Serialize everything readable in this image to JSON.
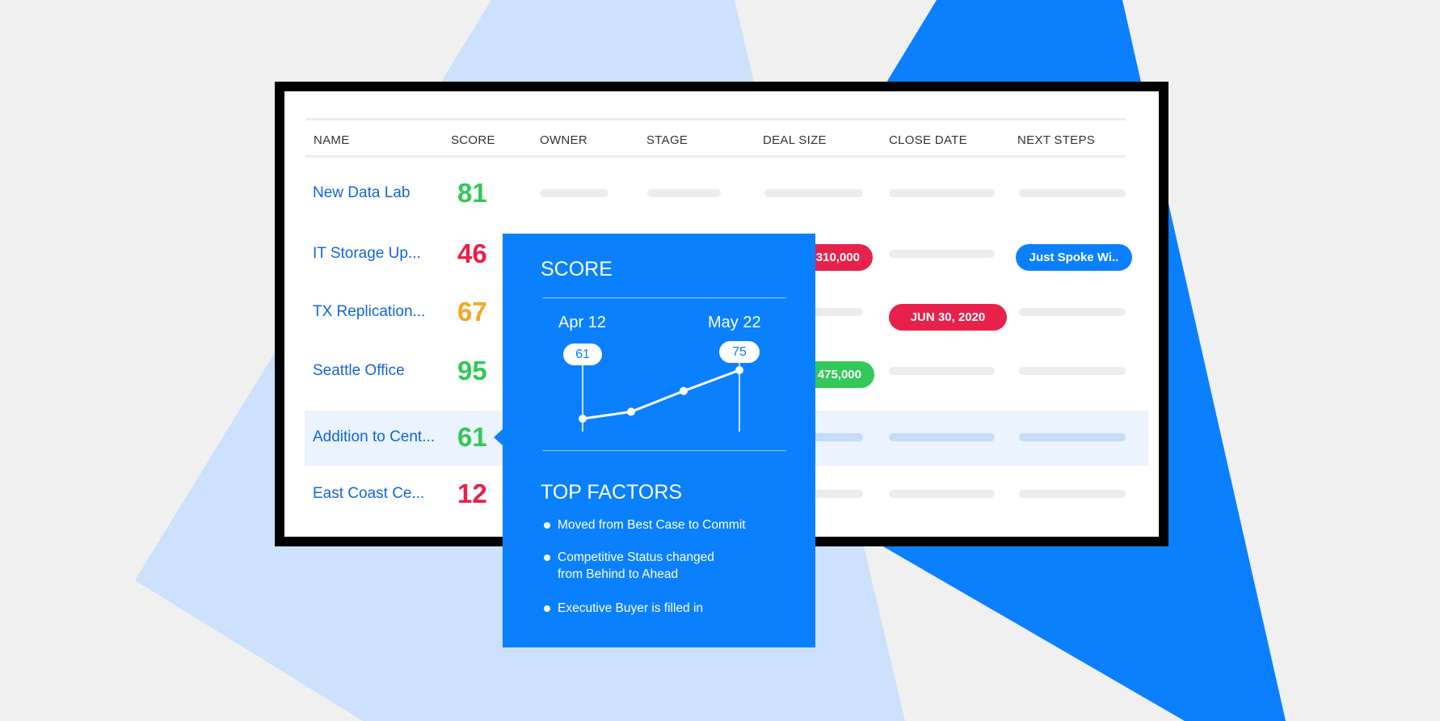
{
  "colors": {
    "brand_blue": "#0a80ff",
    "light_blue": "#cce1fb",
    "green": "#34c759",
    "red": "#e8214b",
    "orange": "#f5a623",
    "link": "#1565d8"
  },
  "table": {
    "headers": [
      "NAME",
      "SCORE",
      "OWNER",
      "STAGE",
      "DEAL SIZE",
      "CLOSE DATE",
      "NEXT STEPS"
    ],
    "rows": [
      {
        "name": "New Data Lab",
        "score": "81",
        "score_color": "#34c759"
      },
      {
        "name": "IT Storage Up...",
        "score": "46",
        "score_color": "#e8214b",
        "deal_size": "310,000",
        "next_steps": "Just Spoke Wi.."
      },
      {
        "name": "TX Replication...",
        "score": "67",
        "score_color": "#f5a623",
        "close_date": "JUN 30, 2020"
      },
      {
        "name": "Seattle Office",
        "score": "95",
        "score_color": "#34c759",
        "deal_size": "475,000"
      },
      {
        "name": "Addition to Cent...",
        "score": "61",
        "score_color": "#34c759",
        "selected": true
      },
      {
        "name": "East Coast Ce...",
        "score": "12",
        "score_color": "#e8214b"
      }
    ]
  },
  "popup": {
    "score_title": "SCORE",
    "start_date": "Apr 12",
    "end_date": "May 22",
    "start_value": "61",
    "end_value": "75",
    "trend": [
      61,
      63,
      69,
      75
    ],
    "factors_title": "TOP FACTORS",
    "factors": [
      "Moved from Best Case to Commit",
      "Competitive Status changed\nfrom Behind to Ahead",
      "Executive Buyer is filled in"
    ]
  }
}
